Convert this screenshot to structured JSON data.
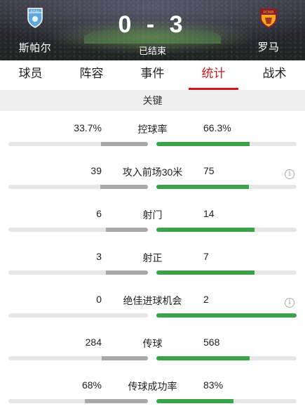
{
  "header": {
    "home_team": "斯帕尔",
    "away_team": "罗马",
    "home_crest_text": "S.P.A.L",
    "away_crest_text": "ROMA",
    "score": "0 - 3",
    "status": "已结束"
  },
  "tabs": [
    {
      "label": "球员"
    },
    {
      "label": "阵容"
    },
    {
      "label": "事件"
    },
    {
      "label": "统计",
      "active": true
    },
    {
      "label": "战术"
    }
  ],
  "section": {
    "title": "关键"
  },
  "stats": [
    {
      "name": "控球率",
      "home": "33.7%",
      "away": "66.3%",
      "home_ratio": 0.337,
      "away_ratio": 0.663,
      "info": false
    },
    {
      "name": "攻入前场30米",
      "home": "39",
      "away": "75",
      "home_ratio": 0.342,
      "away_ratio": 0.658,
      "info": true
    },
    {
      "name": "射门",
      "home": "6",
      "away": "14",
      "home_ratio": 0.3,
      "away_ratio": 0.7,
      "info": false
    },
    {
      "name": "射正",
      "home": "3",
      "away": "7",
      "home_ratio": 0.3,
      "away_ratio": 0.7,
      "info": false
    },
    {
      "name": "绝佳进球机会",
      "home": "0",
      "away": "2",
      "home_ratio": 0.0,
      "away_ratio": 1.0,
      "info": true
    },
    {
      "name": "传球",
      "home": "284",
      "away": "568",
      "home_ratio": 0.333,
      "away_ratio": 0.667,
      "info": false
    },
    {
      "name": "传球成功率",
      "home": "68%",
      "away": "83%",
      "home_ratio": 0.45,
      "away_ratio": 0.55,
      "info": false
    }
  ],
  "colors": {
    "accent": "#cc1a1a",
    "away_bar": "#3aa34a",
    "home_bar": "#a8a8a8"
  },
  "icons": {
    "info": "info-icon"
  }
}
